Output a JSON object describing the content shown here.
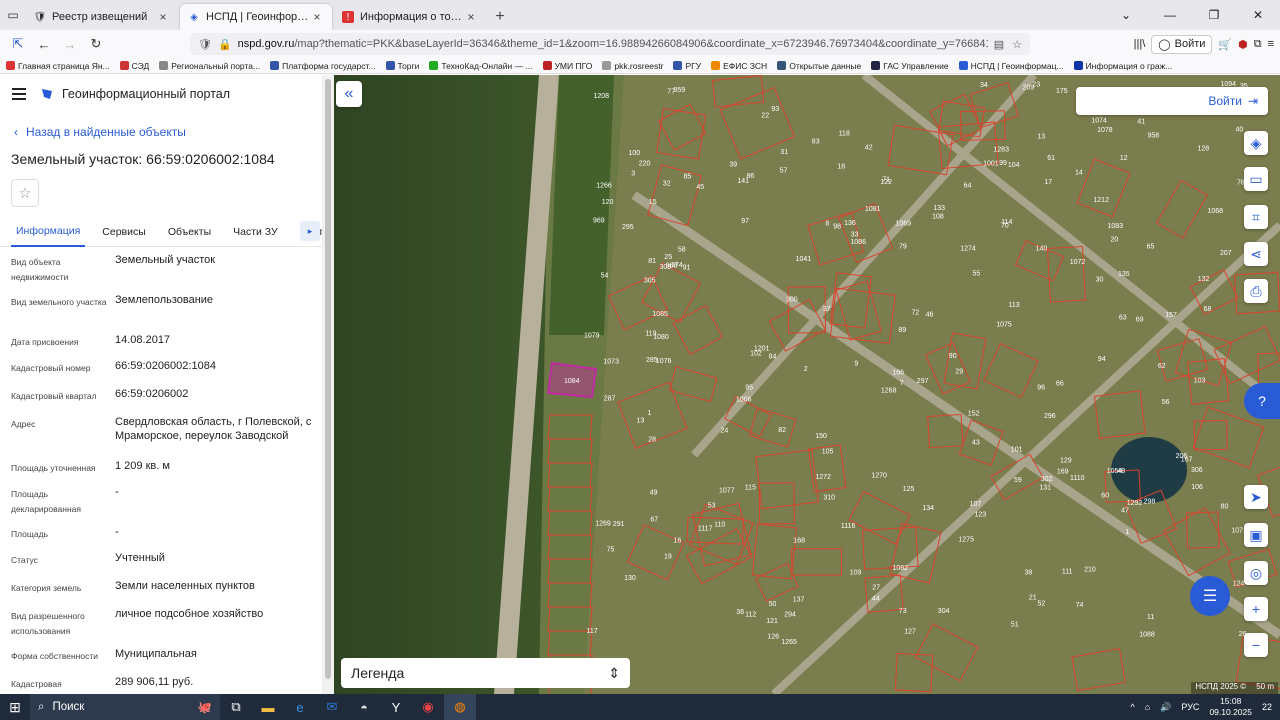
{
  "browser": {
    "tabs": [
      {
        "label": "Реестр извещений",
        "icon": "shield-icon",
        "active": false
      },
      {
        "label": "НСПД | Геоинформационный",
        "icon": "nspd-icon",
        "active": true
      },
      {
        "label": "Информация о торгах — Глав",
        "icon": "torgi-icon",
        "active": false
      }
    ],
    "url_prefix": "nspd.gov.ru",
    "url_rest": "/map?thematic=PKK&baseLayerId=36346&theme_id=1&zoom=16.98894266084906&coordinate_x=6723946.76973404&coordinate_y=7668414.404414791&is_copy_url=",
    "login_label": "Войти",
    "bookmarks": [
      {
        "label": "Главная страница Ян...",
        "color": "#d33"
      },
      {
        "label": "СЭД",
        "color": "#c33"
      },
      {
        "label": "Региональный порта...",
        "color": "#888"
      },
      {
        "label": "Платформа государст...",
        "color": "#35a"
      },
      {
        "label": "Торги",
        "color": "#35a"
      },
      {
        "label": "ТехноКад-Онлайн — ...",
        "color": "#2a2"
      },
      {
        "label": "УМИ ПГО",
        "color": "#b22"
      },
      {
        "label": "pkk.rosreestr",
        "color": "#999"
      },
      {
        "label": "РГУ",
        "color": "#35a"
      },
      {
        "label": "ЕФИС ЗСН",
        "color": "#e80"
      },
      {
        "label": "Открытые данные",
        "color": "#357"
      },
      {
        "label": "ГАС Управление",
        "color": "#224"
      },
      {
        "label": "НСПД | Геоинформац...",
        "color": "#2a5bd7"
      },
      {
        "label": "Информация о граж...",
        "color": "#13a"
      }
    ]
  },
  "sidebar": {
    "app_title": "Геоинформационный портал",
    "back_label": "Назад в найденные объекты",
    "object_title": "Земельный участок: 66:59:0206002:1084",
    "tabs": [
      "Информация",
      "Сервисы",
      "Объекты",
      "Части ЗУ",
      "Состав"
    ],
    "properties": [
      {
        "key": "Вид объекта недвижимости",
        "value": "Земельный участок"
      },
      {
        "key": "Вид земельного участка",
        "value": "Землепользование"
      },
      {
        "key": "Дата присвоения",
        "value": "14.08.2017"
      },
      {
        "key": "Кадастровый номер",
        "value": "66:59:0206002:1084"
      },
      {
        "key": "Кадастровый квартал",
        "value": "66:59:0206002"
      },
      {
        "key": "Адрес",
        "value": "Свердловская область, г Полевской, с Мраморское, переулок Заводской"
      },
      {
        "key": "Площадь уточненная",
        "value": "1 209 кв. м"
      },
      {
        "key": "Площадь декларированная",
        "value": "-"
      },
      {
        "key": "Площадь",
        "value": "-"
      },
      {
        "key": "Статус",
        "value": "Учтенный"
      },
      {
        "key": "Категория земель",
        "value": "Земли населенных пунктов"
      },
      {
        "key": "Вид разрешенного использования",
        "value": "личное подсобное хозяйство"
      },
      {
        "key": "Форма собственности",
        "value": "Муниципальная"
      },
      {
        "key": "Кадастровая",
        "value": "289 906,11 руб."
      }
    ]
  },
  "map": {
    "login_label": "Войти",
    "legend_label": "Легенда",
    "attribution": "НСПД 2025 ©",
    "scale_label": "50 m",
    "selected_parcel": "1084",
    "parcel_labels": [
      "294",
      "1001",
      "302",
      "969",
      "988",
      "295",
      "297",
      "304",
      "305",
      "220",
      "91",
      "309",
      "1085",
      "1084",
      "168",
      "166",
      "167",
      "310",
      "1069",
      "1083",
      "1075",
      "1082",
      "1076",
      "1081",
      "1054",
      "1077",
      "1080",
      "1074",
      "1086",
      "1079",
      "1072",
      "1073",
      "1268",
      "1269",
      "1270",
      "1078",
      "1071",
      "1068",
      "300",
      "306",
      "157",
      "1116",
      "1117",
      "152",
      "150",
      "119",
      "118",
      "108",
      "117",
      "114",
      "112",
      "115",
      "113",
      "958",
      "959",
      "210",
      "209",
      "1266",
      "1265",
      "1208",
      "1006",
      "1283",
      "1201",
      "285",
      "287",
      "169",
      "207",
      "206",
      "175",
      "174",
      "134",
      "123",
      "124",
      "141",
      "140",
      "135",
      "136",
      "137",
      "1094",
      "1041",
      "1088",
      "1212",
      "1272",
      "1275",
      "1274",
      "1292",
      "298",
      "296",
      "291",
      "92",
      "89",
      "18",
      "8",
      "86",
      "85",
      "84",
      "83",
      "17",
      "3",
      "1",
      "2",
      "13",
      "11",
      "9",
      "104",
      "103",
      "102",
      "100",
      "101",
      "110",
      "111",
      "105",
      "107",
      "106",
      "109",
      "1110",
      "35",
      "28",
      "26",
      "22",
      "20",
      "21",
      "15",
      "12",
      "19",
      "1",
      "7",
      "13",
      "14",
      "16",
      "23",
      "24",
      "25",
      "27",
      "29",
      "30",
      "31",
      "32",
      "33",
      "34",
      "36",
      "37",
      "38",
      "39",
      "40",
      "41",
      "42",
      "43",
      "44",
      "45",
      "46",
      "47",
      "48",
      "49",
      "50",
      "51",
      "52",
      "53",
      "54",
      "55",
      "56",
      "57",
      "58",
      "59",
      "60",
      "61",
      "62",
      "63",
      "64",
      "65",
      "66",
      "67",
      "68",
      "69",
      "70",
      "71",
      "72",
      "73",
      "74",
      "75",
      "76",
      "77",
      "78",
      "79",
      "80",
      "81",
      "82",
      "90",
      "93",
      "94",
      "95",
      "96",
      "97",
      "98",
      "99",
      "120",
      "121",
      "122",
      "125",
      "126",
      "127",
      "128",
      "129",
      "130",
      "131",
      "132",
      "133"
    ]
  },
  "taskbar": {
    "search_label": "Поиск",
    "language": "РУС",
    "time": "15:08",
    "date": "09.10.2025",
    "notifications": "22"
  }
}
